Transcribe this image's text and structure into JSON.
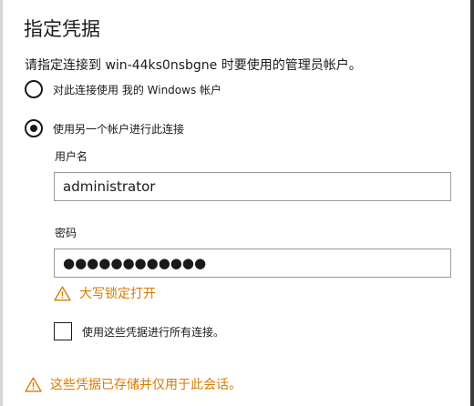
{
  "dialog": {
    "title": "指定凭据",
    "prompt": "请指定连接到 win-44ks0nsbgne 时要使用的管理员帐户。"
  },
  "options": {
    "use_my_account": {
      "label": "对此连接使用 我的 Windows 帐户",
      "selected": false
    },
    "use_other_account": {
      "label": "使用另一个帐户进行此连接",
      "selected": true
    }
  },
  "username": {
    "label": "用户名",
    "value": "administrator"
  },
  "password": {
    "label": "密码",
    "value": "●●●●●●●●●●●●"
  },
  "caps_lock_warning": {
    "text": "大写锁定打开",
    "icon": "warning-triangle-icon"
  },
  "remember": {
    "label": "使用这些凭据进行所有连接。",
    "checked": false
  },
  "session_notice": {
    "text": "这些凭据已存储并仅用于此会话。",
    "icon": "warning-triangle-icon"
  },
  "colors": {
    "warning": "#d97a00",
    "text": "#1a1a1a",
    "field_border": "#999999"
  }
}
